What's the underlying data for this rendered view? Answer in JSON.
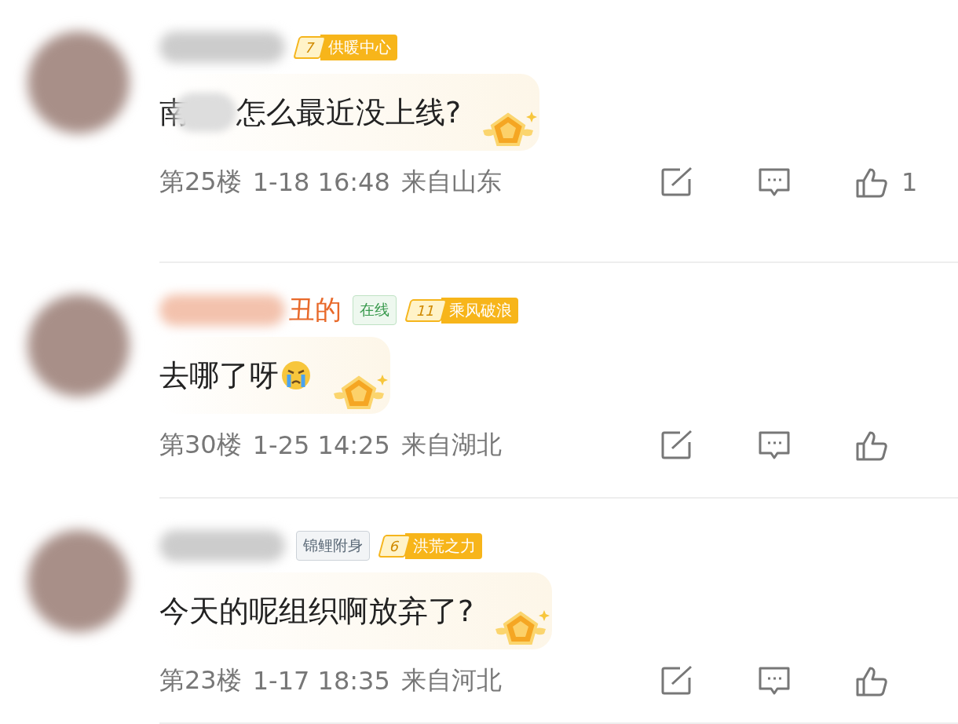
{
  "comments": [
    {
      "level": {
        "number": "7",
        "title": "供暖中心"
      },
      "content_prefix": "南",
      "content": "怎么最近没上线?",
      "floor": "第25楼",
      "time": "1-18 16:48",
      "location": "来自山东",
      "likes": "1"
    },
    {
      "name_visible": "丑的",
      "tags": [
        {
          "kind": "online",
          "label": "在线"
        }
      ],
      "level": {
        "number": "11",
        "title": "乘风破浪"
      },
      "content": "去哪了呀",
      "emoji": true,
      "floor": "第30楼",
      "time": "1-25 14:25",
      "location": "来自湖北"
    },
    {
      "tags": [
        {
          "kind": "title",
          "label": "锦鲤附身"
        }
      ],
      "level": {
        "number": "6",
        "title": "洪荒之力"
      },
      "content": "今天的呢组织啊放弃了?",
      "floor": "第23楼",
      "time": "1-17 18:35",
      "location": "来自河北"
    }
  ]
}
